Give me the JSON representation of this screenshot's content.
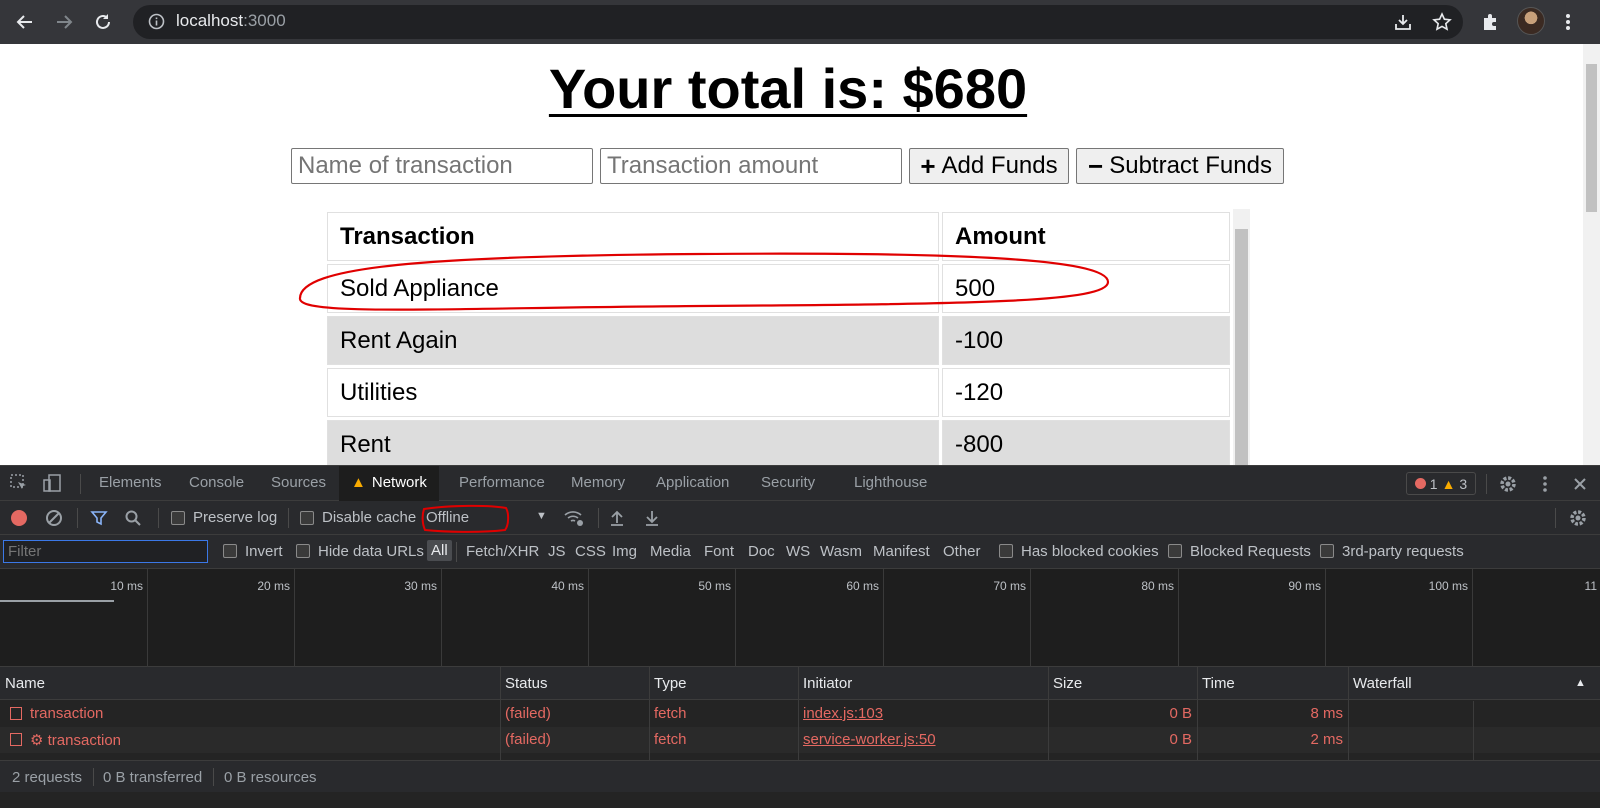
{
  "browser": {
    "url_host": "localhost",
    "url_port": ":3000"
  },
  "page": {
    "title": "Your total is: $680",
    "name_input": {
      "placeholder": "Name of transaction",
      "value": ""
    },
    "amount_input": {
      "placeholder": "Transaction amount",
      "value": ""
    },
    "add_button": {
      "glyph": "+",
      "label": "Add Funds"
    },
    "subtract_button": {
      "glyph": "−",
      "label": "Subtract Funds"
    },
    "table": {
      "headers": [
        "Transaction",
        "Amount"
      ],
      "rows": [
        {
          "name": "Sold Appliance",
          "amount": "500"
        },
        {
          "name": "Rent Again",
          "amount": "-100"
        },
        {
          "name": "Utilities",
          "amount": "-120"
        },
        {
          "name": "Rent",
          "amount": "-800"
        }
      ]
    },
    "annotation_color": "#e00000"
  },
  "devtools": {
    "tabs": [
      "Elements",
      "Console",
      "Sources",
      "Network",
      "Performance",
      "Memory",
      "Application",
      "Security",
      "Lighthouse"
    ],
    "active_tab": "Network",
    "error_count": "1",
    "warning_count": "3",
    "toolbar": {
      "preserve_log": "Preserve log",
      "disable_cache": "Disable cache",
      "throttling": "Offline"
    },
    "filter": {
      "placeholder": "Filter",
      "invert": "Invert",
      "hide_data_urls": "Hide data URLs",
      "types": [
        "All",
        "Fetch/XHR",
        "JS",
        "CSS",
        "Img",
        "Media",
        "Font",
        "Doc",
        "WS",
        "Wasm",
        "Manifest",
        "Other"
      ],
      "has_blocked_cookies": "Has blocked cookies",
      "blocked_requests": "Blocked Requests",
      "third_party": "3rd-party requests"
    },
    "overview_ticks": [
      "10 ms",
      "20 ms",
      "30 ms",
      "40 ms",
      "50 ms",
      "60 ms",
      "70 ms",
      "80 ms",
      "90 ms",
      "100 ms",
      "11"
    ],
    "columns": [
      "Name",
      "Status",
      "Type",
      "Initiator",
      "Size",
      "Time",
      "Waterfall"
    ],
    "requests": [
      {
        "name": "transaction",
        "gear": "",
        "status": "(failed)",
        "type": "fetch",
        "initiator": "index.js:103",
        "size": "0 B",
        "time": "8 ms"
      },
      {
        "name": "transaction",
        "gear": "⚙ ",
        "status": "(failed)",
        "type": "fetch",
        "initiator": "service-worker.js:50",
        "size": "0 B",
        "time": "2 ms"
      }
    ],
    "status_bar": {
      "requests": "2 requests",
      "transferred": "0 B transferred",
      "resources": "0 B resources"
    },
    "colors": {
      "error": "#e46962",
      "warning": "#f9ab00",
      "focus": "#3b78e7"
    }
  }
}
